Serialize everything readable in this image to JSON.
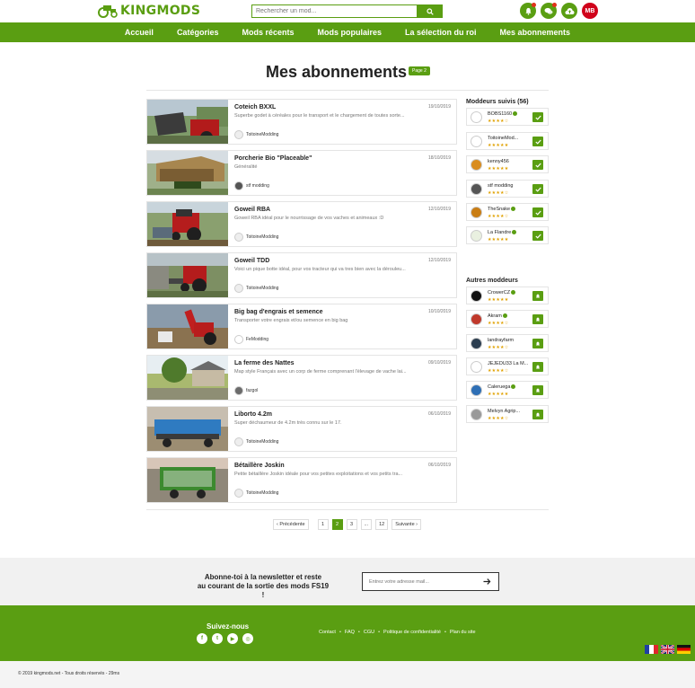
{
  "header": {
    "logo_text": "KINGMODS",
    "search_placeholder": "Rechercher un mod...",
    "user_initials": "MB"
  },
  "nav": {
    "items": [
      {
        "label": "Accueil"
      },
      {
        "label": "Catégories"
      },
      {
        "label": "Mods récents"
      },
      {
        "label": "Mods populaires"
      },
      {
        "label": "La sélection du roi"
      },
      {
        "label": "Mes abonnements"
      }
    ]
  },
  "page": {
    "title": "Mes abonnements",
    "page_badge": "Page 2"
  },
  "mods": [
    {
      "name": "Coteich BXXL",
      "date": "19/10/2019",
      "desc": "Superbe godet à céréales pour le transport et le chargement de toutes sorte...",
      "author": "ToitoineModding"
    },
    {
      "name": "Porcherie Bio \"Placeable\"",
      "date": "18/10/2019",
      "desc": "Généralité",
      "author": "stf modding"
    },
    {
      "name": "Goweil RBA",
      "date": "12/10/2019",
      "desc": "Goweil RBA idéal pour le nourrissage de vos vaches et animeaux :D",
      "author": "ToitoineModding"
    },
    {
      "name": "Goweil TDD",
      "date": "12/10/2019",
      "desc": "Voici un pique botte idéal, pour vos tracteur qui va tres bien avec la dérouleu...",
      "author": "ToitoineModding"
    },
    {
      "name": "Big bag d'engrais et semence",
      "date": "10/10/2019",
      "desc": "Transporter votre engrais et/ou semence en big bag",
      "author": "FeModding"
    },
    {
      "name": "La ferme des Nattes",
      "date": "09/10/2019",
      "desc": "Map style Français avec un corp de ferme comprenant l'élevage de vache lai...",
      "author": "fazgol"
    },
    {
      "name": "Liborto 4.2m",
      "date": "06/10/2019",
      "desc": "Super déchaumeur de 4.2m très connu sur le 17.",
      "author": "ToitoineModding"
    },
    {
      "name": "Bétaillère Joskin",
      "date": "06/10/2019",
      "desc": "Petite bétaillère Joskin idéale pour vos petites exploitations et vos petits tra...",
      "author": "ToitoineModding"
    }
  ],
  "sidebar": {
    "followed_title": "Moddeurs suivis (56)",
    "followed": [
      {
        "name": "BOBS1160",
        "stars": "★★★★☆"
      },
      {
        "name": "ToitoineMod...",
        "stars": "★★★★★"
      },
      {
        "name": "kenny456",
        "stars": "★★★★★"
      },
      {
        "name": "stf modding",
        "stars": "★★★★☆"
      },
      {
        "name": "TheSnake",
        "stars": "★★★★☆"
      },
      {
        "name": "La Flandre",
        "stars": "★★★★★"
      }
    ],
    "others_title": "Autres moddeurs",
    "others": [
      {
        "name": "CrowerCZ",
        "stars": "★★★★★"
      },
      {
        "name": "Akram",
        "stars": "★★★★☆"
      },
      {
        "name": "landrayfarm",
        "stars": "★★★★☆"
      },
      {
        "name": "JEJEDU33 La M...",
        "stars": "★★★★☆"
      },
      {
        "name": "Caleruega",
        "stars": "★★★★★"
      },
      {
        "name": "Melvyn Agrip...",
        "stars": "★★★★☆"
      }
    ]
  },
  "pagination": {
    "prev": "Précédente",
    "pages": [
      "1",
      "2",
      "3",
      "...",
      "12"
    ],
    "next": "Suivante"
  },
  "newsletter": {
    "line1": "Abonne-toi à la newsletter et reste",
    "line2": "au courant de la sortie des mods FS19 !",
    "placeholder": "Entrez votre adresse mail..."
  },
  "footer": {
    "follow_label": "Suivez-nous",
    "socials": [
      "f",
      "t",
      "▶",
      "◎"
    ],
    "links": [
      "Contact",
      "FAQ",
      "CGU",
      "Politique de confidentialité",
      "Plan du site"
    ],
    "copyright": "© 2019 kingmods.net - Tous droits réservés - 29ms"
  },
  "colors": {
    "brand_green": "#5a9e12",
    "avatar_red": "#d0021b"
  }
}
